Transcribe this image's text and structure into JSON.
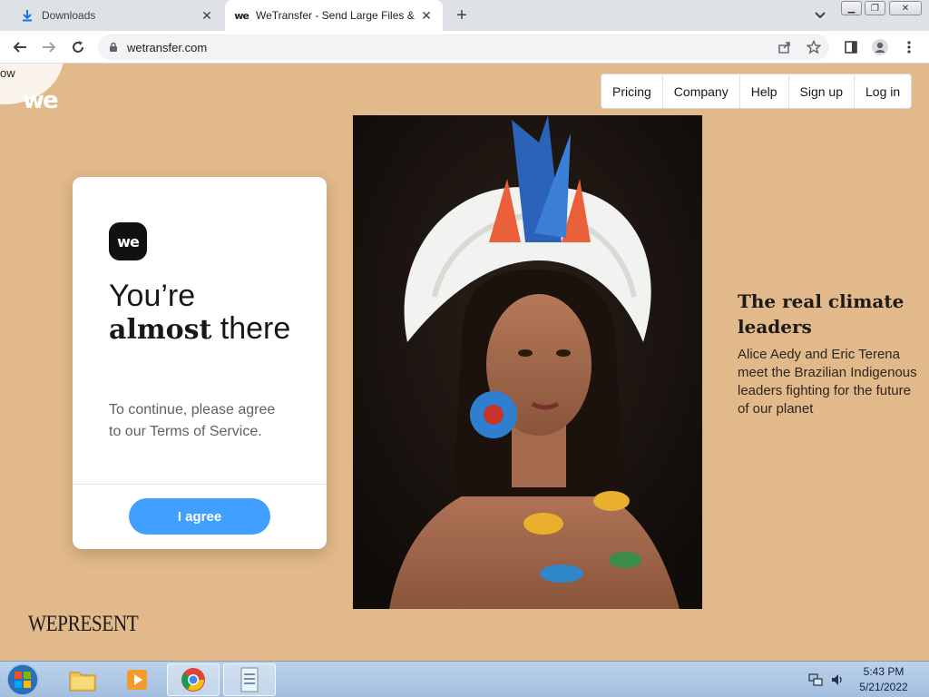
{
  "browser": {
    "tabs": [
      {
        "title": "Downloads",
        "active": false
      },
      {
        "title": "WeTransfer - Send Large Files & Share",
        "active": true
      }
    ],
    "url": "wetransfer.com"
  },
  "page": {
    "logo_blob_text": "ow",
    "logo": "we",
    "nav": [
      "Pricing",
      "Company",
      "Help",
      "Sign up",
      "Log in"
    ],
    "card": {
      "logo": "we",
      "heading_line1": "You’re",
      "heading_bold": "almost",
      "heading_rest": " there",
      "text": "To continue, please agree to our Terms of Service.",
      "agree_label": "I agree"
    },
    "story": {
      "title": "The real climate leaders",
      "text": "Alice Aedy and Eric Terena meet the Brazilian Indigenous leaders fighting for the future of our planet"
    },
    "wepresent": "WEPRESENT",
    "colors": {
      "background": "#e2b98a",
      "accent": "#409fff"
    }
  },
  "taskbar": {
    "time": "5:43 PM",
    "date": "5/21/2022"
  }
}
